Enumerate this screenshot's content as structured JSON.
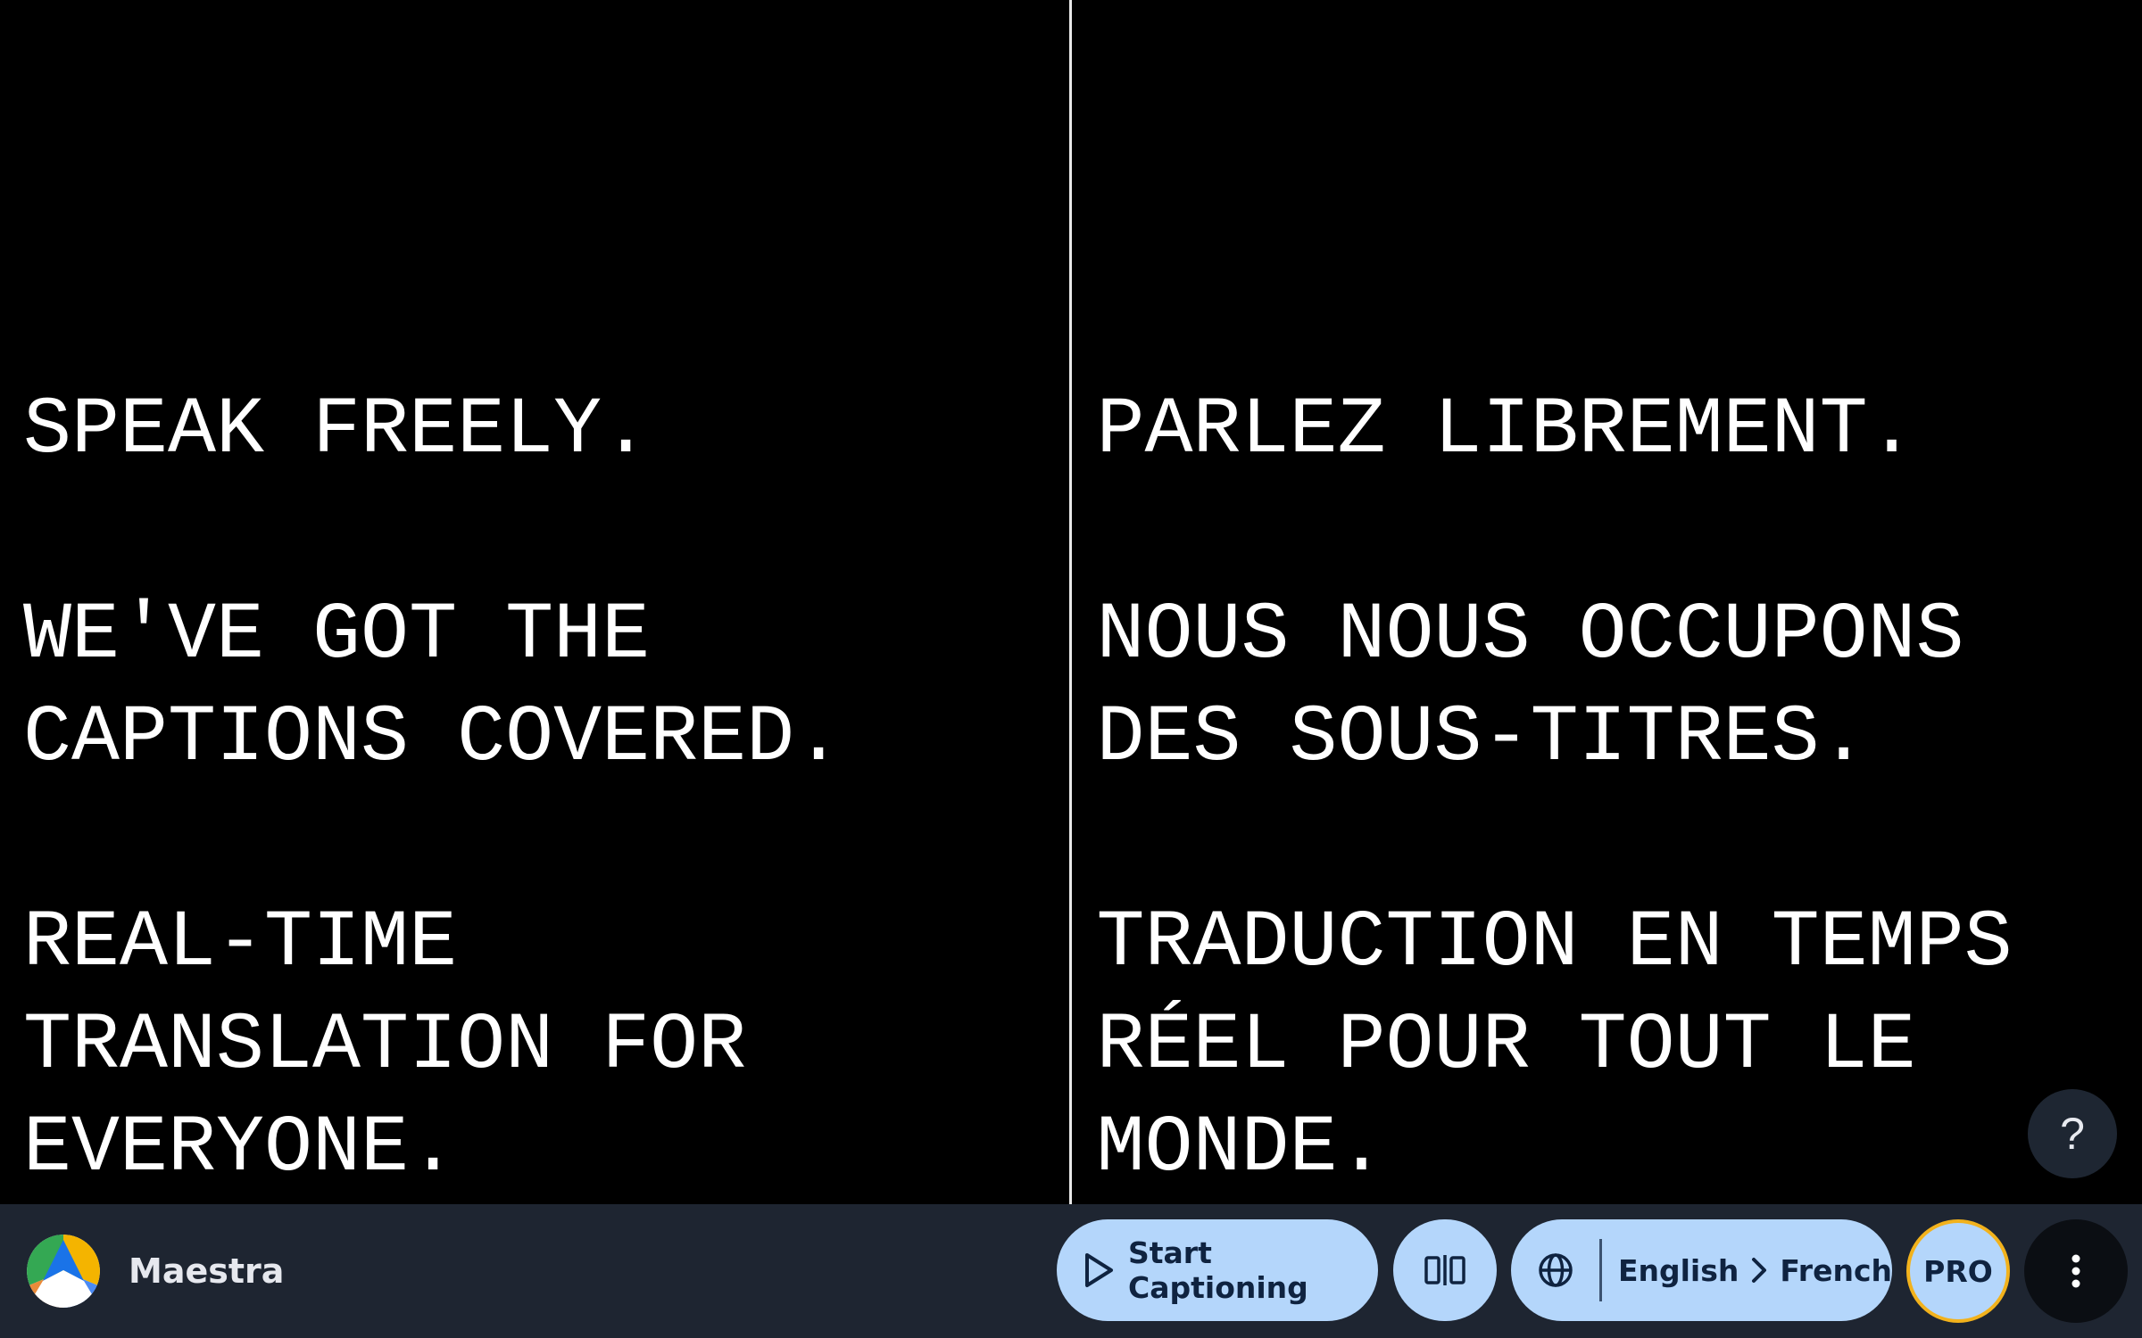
{
  "captions": {
    "source": {
      "language": "English",
      "lines": [
        "SPEAK FREELY.",
        "WE'VE GOT THE\nCAPTIONS COVERED.",
        "REAL-TIME\nTRANSLATION FOR\nEVERYONE."
      ]
    },
    "translation": {
      "language": "French",
      "lines": [
        "PARLEZ LIBREMENT.",
        "NOUS NOUS OCCUPONS\nDES SOUS-TITRES.",
        "TRADUCTION EN TEMPS\nRÉEL POUR TOUT LE\nMONDE."
      ]
    }
  },
  "help": {
    "label": "?"
  },
  "toolbar": {
    "brand_name": "Maestra",
    "start_label": "Start Captioning",
    "source_language": "English",
    "target_language": "French",
    "pro_label": "PRO"
  },
  "icons": {
    "logo": "maestra-logo-icon",
    "play": "play-icon",
    "split_view": "split-view-icon",
    "globe": "globe-icon",
    "chevron": "chevron-right-icon",
    "more": "more-vertical-icon"
  },
  "colors": {
    "background": "#000000",
    "caption_text": "#ffffff",
    "toolbar_background": "#1e2531",
    "pill_background": "#b4d6fb",
    "pill_text": "#0f2340",
    "pro_border": "#f2b21c"
  }
}
